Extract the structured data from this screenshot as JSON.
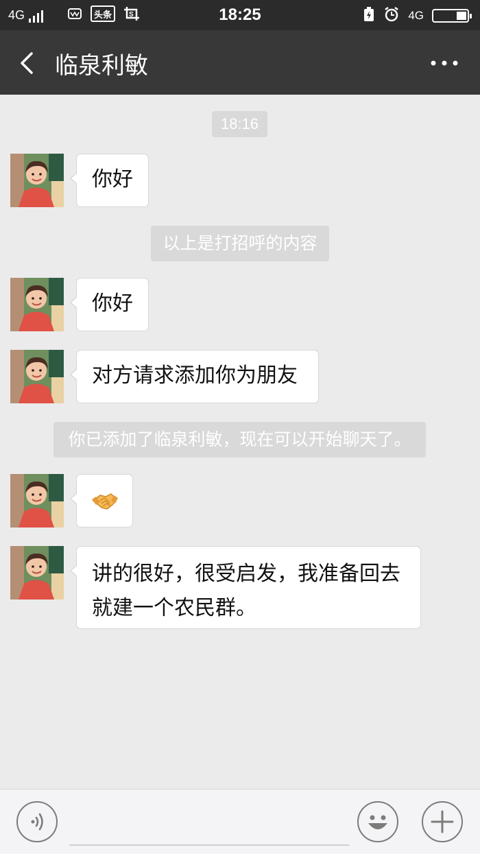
{
  "status_bar": {
    "network": "4G",
    "network_right": "4G",
    "time": "18:25",
    "app_toutiao": "头条",
    "icons": [
      "signal-icon",
      "vivo-icon",
      "toutiao-icon",
      "screenshot-icon",
      "charging-icon",
      "alarm-icon",
      "battery-icon"
    ]
  },
  "header": {
    "title": "临泉利敏",
    "back_icon": "chevron-left-icon",
    "more_icon": "more-dots-icon"
  },
  "chat": {
    "timestamp": "18:16",
    "messages": [
      {
        "type": "text",
        "text": "你好"
      },
      {
        "type": "system",
        "text": "以上是打招呼的内容"
      },
      {
        "type": "text",
        "text": "你好"
      },
      {
        "type": "text",
        "text": "对方请求添加你为朋友"
      },
      {
        "type": "system",
        "text": "你已添加了临泉利敏，现在可以开始聊天了。"
      },
      {
        "type": "emoji",
        "emoji": "handshake-emoji"
      },
      {
        "type": "text",
        "text": "讲的很好，很受启发，我准备回去就建一个农民群。"
      }
    ]
  },
  "input_bar": {
    "voice_icon": "voice-icon",
    "emoji_icon": "emoji-icon",
    "plus_icon": "plus-icon",
    "input_value": ""
  },
  "colors": {
    "status_bg": "#2b2b2b",
    "header_bg": "#383838",
    "chat_bg": "#ebebeb",
    "system_bg": "#d9d9d9",
    "bubble_bg": "#ffffff"
  }
}
